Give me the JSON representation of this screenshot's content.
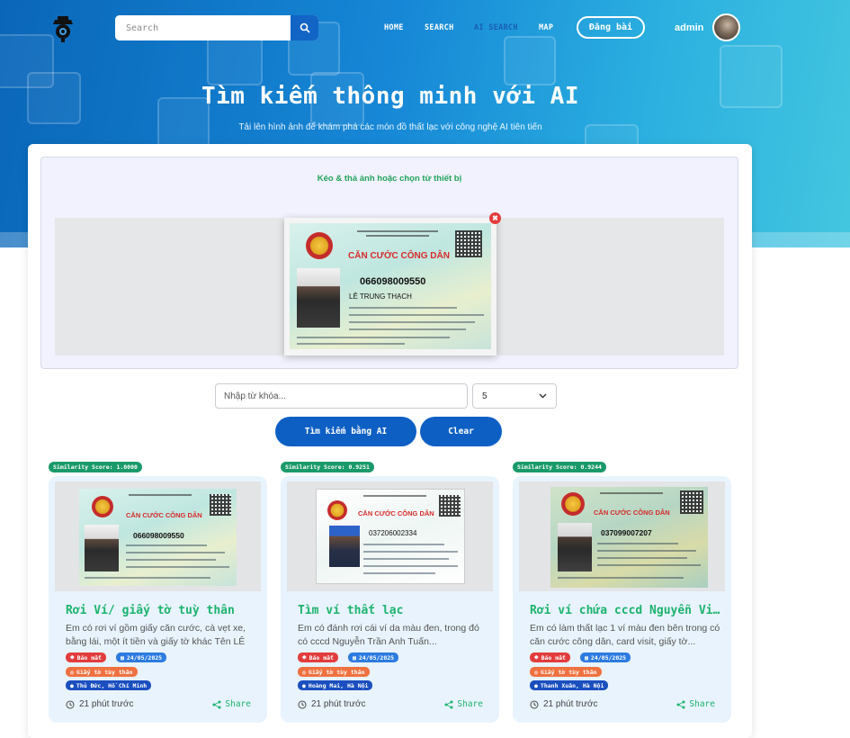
{
  "header": {
    "search_placeholder": "Search",
    "nav": [
      {
        "label": "HOME",
        "active": false
      },
      {
        "label": "SEARCH",
        "active": false
      },
      {
        "label": "AI SEARCH",
        "active": true
      },
      {
        "label": "MAP",
        "active": false
      }
    ],
    "post_button": "Đăng bài",
    "username": "admin"
  },
  "hero": {
    "title": "Tìm kiếm thông minh với AI",
    "subtitle": "Tải lên hình ảnh để khám phá các món đồ thất lạc với công nghệ AI tiên tiến"
  },
  "upload": {
    "dropzone_label": "Kéo & thả ảnh hoặc chọn từ thiết bị",
    "remove_symbol": "✖",
    "preview_card": {
      "title": "CĂN CƯỚC CÔNG DÂN",
      "number": "066098009550",
      "name": "LÊ TRUNG THẠCH"
    }
  },
  "search": {
    "keyword_placeholder": "Nhập từ khóa...",
    "topk_value": "5",
    "ai_button": "Tìm kiếm bằng AI",
    "clear_button": "Clear"
  },
  "results": [
    {
      "score": "Similarity Score: 1.0000",
      "card_title": "CĂN CƯỚC CÔNG DÂN",
      "card_number": "066098009550",
      "title": "Rơi Ví/ giấy tờ tuỳ thân",
      "description": "Em có rơi ví gồm giấy căn cước, cà vẹt xe, bằng lái, một ít tiền và giấy tờ khác Tên LÊ TRUNG THẠCH",
      "status": "Báo mất",
      "date": "24/05/2025",
      "category": "Giấy tờ tùy thân",
      "location": "Thủ Đức, Hồ Chí Minh",
      "time": "21 phút trước",
      "share": "Share"
    },
    {
      "score": "Similarity Score: 0.9251",
      "card_title": "CĂN CƯỚC CÔNG DÂN",
      "card_number": "037206002334",
      "title": "Tìm ví thất lạc",
      "description": "Em có đánh rơi cái ví da màu đen, trong đó có cccd Nguyễn Trần Anh Tuấn...",
      "status": "Báo mất",
      "date": "24/05/2025",
      "category": "Giấy tờ tùy thân",
      "location": "Hoàng Mai, Hà Nội",
      "time": "21 phút trước",
      "share": "Share"
    },
    {
      "score": "Similarity Score: 0.9244",
      "card_title": "CĂN CƯỚC CÔNG DÂN",
      "card_number": "037099007207",
      "title": "Rơi ví chứa cccd Nguyễn Việt Tùng",
      "description": "Em có làm thất lạc 1 ví màu đen bên trong có căn cước công dân, card visit, giấy tờ...",
      "status": "Báo mất",
      "date": "24/05/2025",
      "category": "Giấy tờ tùy thân",
      "location": "Thanh Xuân, Hà Nội",
      "time": "21 phút trước",
      "share": "Share"
    }
  ]
}
